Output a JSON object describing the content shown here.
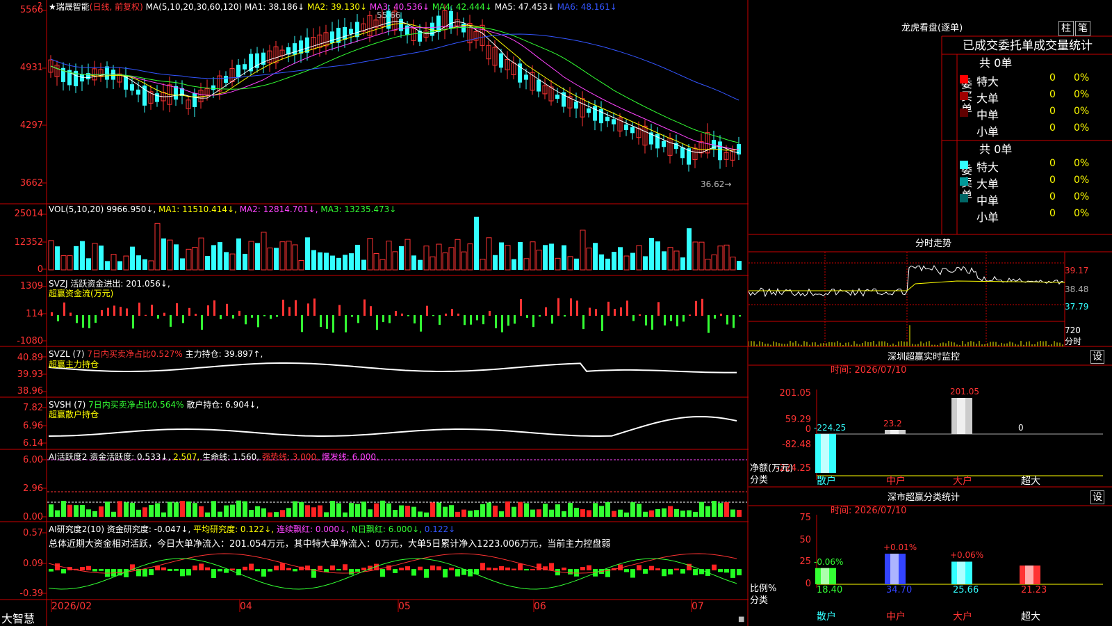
{
  "main_chart": {
    "stock_name": "瑞晟智能",
    "period_note": "(日线, 前复权)",
    "ma_header": [
      {
        "label": "MA(5,10,20,30,60,120)",
        "color": "#ffffff"
      },
      {
        "label": "MA1: 38.186↓",
        "color": "#ffffff"
      },
      {
        "label": "MA2: 39.130↓",
        "color": "#ffff00"
      },
      {
        "label": "MA3: 40.536↓",
        "color": "#ff44ff"
      },
      {
        "label": "MA4: 42.444↓",
        "color": "#33ff33"
      },
      {
        "label": "MA5: 47.453↓",
        "color": "#ffffff"
      },
      {
        "label": "MA6: 48.161↓",
        "color": "#3355ff"
      }
    ],
    "y_ticks": [
      "5566",
      "4931",
      "4297",
      "3662"
    ],
    "high_note": "55.66",
    "low_note": "36.62→"
  },
  "vol_panel": {
    "header": [
      {
        "label": "VOL(5,10,20)",
        "color": "#ffffff"
      },
      {
        "label": "9966.950↓,",
        "color": "#ffffff"
      },
      {
        "label": "MA1: 11510.414↓,",
        "color": "#ffff00"
      },
      {
        "label": "MA2: 12814.701↓,",
        "color": "#ff44ff"
      },
      {
        "label": "MA3: 13235.473↓",
        "color": "#33ff33"
      }
    ],
    "y_ticks": [
      "25014",
      "12352",
      "0"
    ]
  },
  "svzj_panel": {
    "line1": [
      {
        "label": "SVZJ",
        "color": "#ffffff"
      },
      {
        "label": "活跃资金进出: 201.056↓,",
        "color": "#ffffff"
      }
    ],
    "line2": "超赢资金流(万元)",
    "y_ticks": [
      "1309",
      "114",
      "-1080"
    ]
  },
  "svzl_panel": {
    "line1": [
      {
        "label": "SVZL (7)",
        "color": "#ffffff"
      },
      {
        "label": "7日内买卖净占比0.527%",
        "color": "#ff3333"
      },
      {
        "label": "主力持仓: 39.897↑,",
        "color": "#ffffff"
      }
    ],
    "line2": "超赢主力持仓",
    "y_ticks": [
      "40.89",
      "39.93",
      "38.96"
    ]
  },
  "svsh_panel": {
    "line1": [
      {
        "label": "SVSH (7)",
        "color": "#ffffff"
      },
      {
        "label": "7日内买卖净占比0.564%",
        "color": "#33ff33"
      },
      {
        "label": "散户持仓: 6.904↓,",
        "color": "#ffffff"
      }
    ],
    "line2": "超赢散户持仓",
    "y_ticks": [
      "7.82",
      "6.96",
      "6.14"
    ]
  },
  "ai_active_panel": {
    "header": [
      {
        "label": "AI活跃度2",
        "color": "#ffffff"
      },
      {
        "label": "资金活跃度: 0.533↓,",
        "color": "#ffffff"
      },
      {
        "label": "2.507,",
        "color": "#ffff00"
      },
      {
        "label": "生命线: 1.560,",
        "color": "#ffffff"
      },
      {
        "label": "强势线: 3.000,",
        "color": "#ff3333"
      },
      {
        "label": "爆发线: 6.000,",
        "color": "#ff44ff"
      }
    ],
    "y_ticks": [
      "6.00",
      "2.96",
      "0.00"
    ]
  },
  "ai_research_panel": {
    "header": [
      {
        "label": "AI研究度2(10)",
        "color": "#ffffff"
      },
      {
        "label": "资金研究度: -0.047↓,",
        "color": "#ffffff"
      },
      {
        "label": "平均研究度: 0.122↓,",
        "color": "#ffff00"
      },
      {
        "label": "连续飘红: 0.000↓,",
        "color": "#ff44ff"
      },
      {
        "label": "N日飘红: 6.000↓,",
        "color": "#33ff33"
      },
      {
        "label": "0.122↓",
        "color": "#3355ff"
      }
    ],
    "summary": "总体近期大资金相对活跃，今日大单净流入：201.054万元，其中特大单净流入：0万元，大单5日累计净入1223.006万元，当前主力控盘弱",
    "y_ticks": [
      "0.57",
      "0.09",
      "-0.39"
    ]
  },
  "x_axis": {
    "brand": "大智慧",
    "labels": [
      "2026/02",
      "04",
      "05",
      "06",
      "07"
    ]
  },
  "dragon_tiger": {
    "title": "龙虎看盘(逐单)",
    "btn_bar": "柱",
    "btn_pen": "笔",
    "subtitle": "已成交委托单成交量统计",
    "buy_side": {
      "label": "委买单",
      "total": "共 0单",
      "rows": [
        {
          "name": "特大",
          "count": "0",
          "pct": "0%",
          "color": "#ff0000"
        },
        {
          "name": "大单",
          "count": "0",
          "pct": "0%",
          "color": "#a00000"
        },
        {
          "name": "中单",
          "count": "0",
          "pct": "0%",
          "color": "#600000"
        },
        {
          "name": "小单",
          "count": "0",
          "pct": "0%",
          "color": ""
        }
      ]
    },
    "sell_side": {
      "label": "委卖单",
      "total": "共 0单",
      "rows": [
        {
          "name": "特大",
          "count": "0",
          "pct": "0%",
          "color": "#33ffff"
        },
        {
          "name": "大单",
          "count": "0",
          "pct": "0%",
          "color": "#009999"
        },
        {
          "name": "中单",
          "count": "0",
          "pct": "0%",
          "color": "#006666"
        },
        {
          "name": "小单",
          "count": "0",
          "pct": "0%",
          "color": ""
        }
      ]
    }
  },
  "intraday": {
    "title": "分时走势",
    "right_ticks": [
      "39.17",
      "38.48",
      "37.79",
      "720",
      "分时"
    ]
  },
  "shenzhen_monitor": {
    "title": "深圳超赢实时监控",
    "settings": "设",
    "time_label": "时间: 2026/07/10",
    "y_ticks": [
      "201.05",
      "59.29",
      "0",
      "-82.48",
      "-224.25"
    ],
    "axis_label": "净额(万元)",
    "axis_label2": "分类",
    "bar_labels": [
      "-224.25",
      "23.2",
      "201.05",
      "0"
    ],
    "categories": [
      "散户",
      "中户",
      "大户",
      "超大"
    ]
  },
  "sz_classify": {
    "title": "深市超赢分类统计",
    "settings": "设",
    "time_label": "时间: 2026/07/10",
    "y_ticks": [
      "75",
      "50",
      "25",
      "0"
    ],
    "axis_label": "比例%",
    "axis_label2": "分类",
    "delta_labels": [
      "-0.06%",
      "+0.01%",
      "+0.06%"
    ],
    "values": [
      "18.40",
      "34.70",
      "25.66",
      "21.23"
    ],
    "categories": [
      "散户",
      "中户",
      "大户",
      "超大"
    ]
  },
  "chart_data": {
    "type": "bar",
    "title": "深圳超赢实时监控",
    "ylabel": "净额(万元)",
    "xlabel": "分类",
    "categories": [
      "散户",
      "中户",
      "大户",
      "超大"
    ],
    "values": [
      -224.25,
      23.2,
      201.05,
      0
    ],
    "ylim": [
      -224.25,
      201.05
    ]
  },
  "colors": {
    "up": "#ff3333",
    "down": "#33ffff",
    "grid": "#cc0000"
  }
}
